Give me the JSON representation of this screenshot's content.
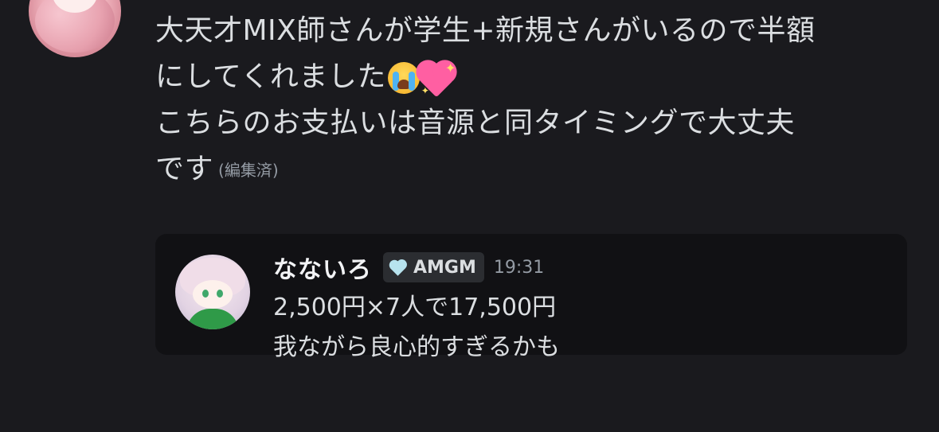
{
  "message": {
    "lines": [
      "大天才MIX師さんが学生+新規さんがいるので半額",
      "にしてくれました",
      "こちらのお支払いは音源と同タイミングで大丈夫",
      "です"
    ],
    "emojis": [
      "loudly-crying-face",
      "sparkling-heart"
    ],
    "edited_label": "(編集済)"
  },
  "reply": {
    "author_name": "なないろ",
    "tag_icon": "light-blue-heart",
    "tag_label": "AMGM",
    "timestamp": "19:31",
    "lines": [
      "2,500円×7人で17,500円",
      "我ながら良心的すぎるかも"
    ]
  },
  "colors": {
    "background": "#1a1a1e",
    "reply_background": "#111114",
    "text": "#dbdee1",
    "muted": "#949ba4"
  }
}
